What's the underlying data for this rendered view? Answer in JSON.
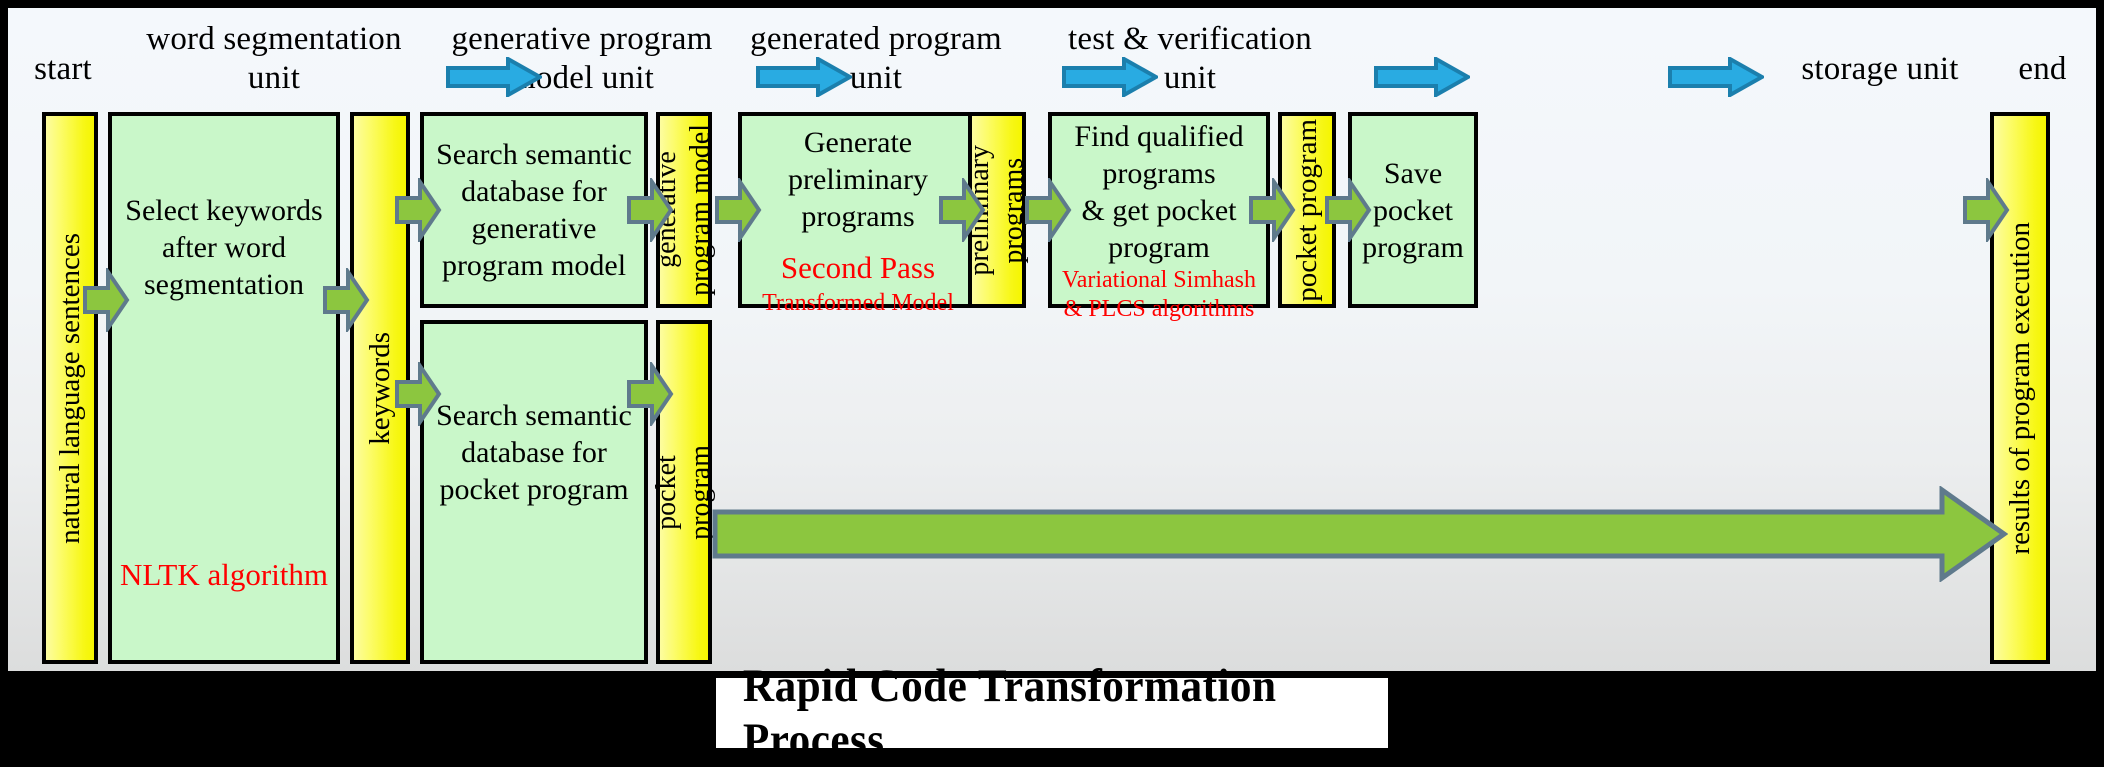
{
  "diagram": {
    "title": "Rapid Code Transformation Process",
    "units": [
      {
        "id": "start",
        "label": "start"
      },
      {
        "id": "word-seg",
        "label": "word segmentation\nunit"
      },
      {
        "id": "gen-model",
        "label": "generative program\nmodel unit"
      },
      {
        "id": "gen-program",
        "label": "generated program\nunit"
      },
      {
        "id": "test-verify",
        "label": "test & verification\nunit"
      },
      {
        "id": "storage",
        "label": "storage unit"
      },
      {
        "id": "end",
        "label": "end"
      }
    ],
    "boxes": {
      "natural_language_sentences": "natural language sentences",
      "select_keywords": "Select keywords after word segmentation",
      "nltk_algorithm": "NLTK  algorithm",
      "keywords": "keywords",
      "search_db_generative": "Search semantic database for generative program model",
      "search_db_pocket": "Search semantic database for pocket program",
      "generative_program_model": "generative program model",
      "pocket_program_1": "pocket program",
      "generate_preliminary": "Generate preliminary programs",
      "second_pass": "Second Pass",
      "transformed_model": "Transformed Model",
      "preliminary_programs": "preliminary programs",
      "find_qualified": "Find qualified programs & get pocket program",
      "variational_simhash": "Variational Simhash",
      "plcs_algorithms": "& PLCS algorithms",
      "pocket_program_2": "pocket program",
      "save_pocket_program": "Save pocket program",
      "results_of_execution": "results of program execution"
    },
    "colors": {
      "green_box": "#c9f7c9",
      "yellow_box": "#f7f717",
      "blue_arrow": "#29abe2",
      "blue_arrow_outline": "#1b7fad",
      "green_arrow": "#8cc63f",
      "green_arrow_outline": "#5f7a8c",
      "red_text": "#ff0000",
      "title_bar": "#000000",
      "title_plate": "#ffffff"
    },
    "arrows": {
      "unit_connector": "blue-chevron-right",
      "flow_connector": "green-block-arrow-right",
      "feedback": "long-green-block-arrow-right"
    }
  }
}
